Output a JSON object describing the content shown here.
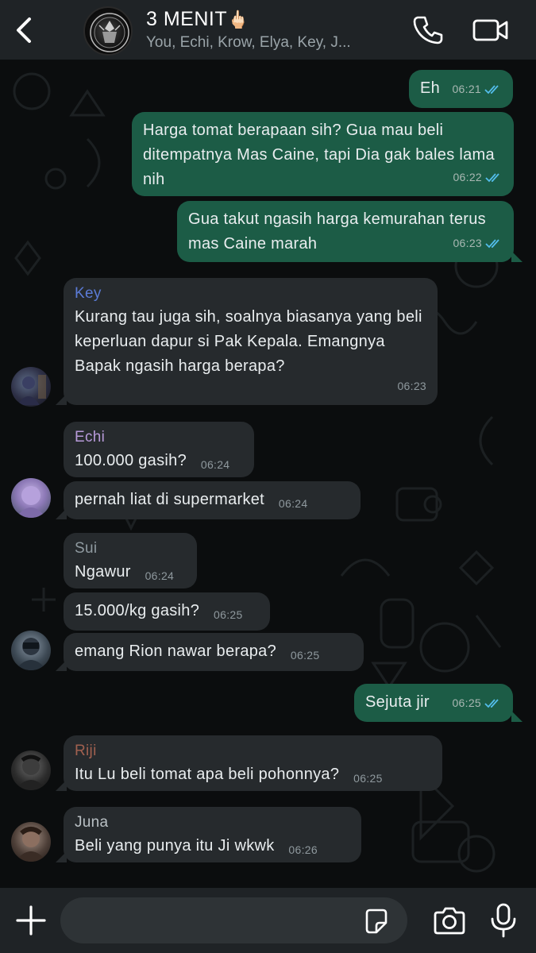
{
  "header": {
    "title": "3 MENIT",
    "title_emoji": "🖕🏻",
    "members": "You, Echi, Krow, Elya, Key, J..."
  },
  "messages": [
    {
      "id": "m1",
      "dir": "out",
      "text": "Eh",
      "time": "06:21",
      "status": "read"
    },
    {
      "id": "m2",
      "dir": "out",
      "text": "Harga tomat berapaan sih? Gua mau beli ditempatnya Mas Caine, tapi Dia gak bales lama nih",
      "time": "06:22",
      "status": "read"
    },
    {
      "id": "m3",
      "dir": "out",
      "text": "Gua takut ngasih harga kemurahan terus mas Caine marah",
      "time": "06:23",
      "status": "read"
    },
    {
      "id": "m4",
      "dir": "in",
      "sender": "Key",
      "sender_color": "#5b7bd6",
      "text": "Kurang tau juga sih, soalnya biasanya yang beli keperluan dapur si Pak Kepala. Emangnya Bapak ngasih harga berapa?",
      "time": "06:23"
    },
    {
      "id": "m5",
      "dir": "in",
      "sender": "Echi",
      "sender_color": "#b79ad9",
      "text": "100.000 gasih?",
      "time": "06:24"
    },
    {
      "id": "m6",
      "dir": "in",
      "text": "pernah liat di supermarket",
      "time": "06:24"
    },
    {
      "id": "m7",
      "dir": "in",
      "sender": "Sui",
      "sender_color": "#8f9aa0",
      "text": "Ngawur",
      "time": "06:24"
    },
    {
      "id": "m8",
      "dir": "in",
      "text": "15.000/kg gasih?",
      "time": "06:25"
    },
    {
      "id": "m9",
      "dir": "in",
      "text": "emang Rion nawar berapa?",
      "time": "06:25"
    },
    {
      "id": "m10",
      "dir": "out",
      "text": "Sejuta jir",
      "time": "06:25",
      "status": "read"
    },
    {
      "id": "m11",
      "dir": "in",
      "sender": "Riji",
      "sender_color": "#a0604f",
      "text": "Itu Lu beli tomat apa beli pohonnya?",
      "time": "06:25"
    },
    {
      "id": "m12",
      "dir": "in",
      "sender": "Juna",
      "sender_color": "#b9c0c4",
      "text": "Beli yang punya itu Ji wkwk",
      "time": "06:26"
    }
  ],
  "composer": {
    "placeholder": ""
  },
  "colors": {
    "outgoing_bubble": "#1c5c46",
    "incoming_bubble": "#262a2d",
    "read_ticks": "#53bdeb",
    "header_bg": "#1f2326"
  },
  "icons": [
    "back-arrow-icon",
    "phone-icon",
    "video-camera-icon",
    "plus-icon",
    "sticker-icon",
    "camera-icon",
    "microphone-icon",
    "double-check-icon"
  ]
}
